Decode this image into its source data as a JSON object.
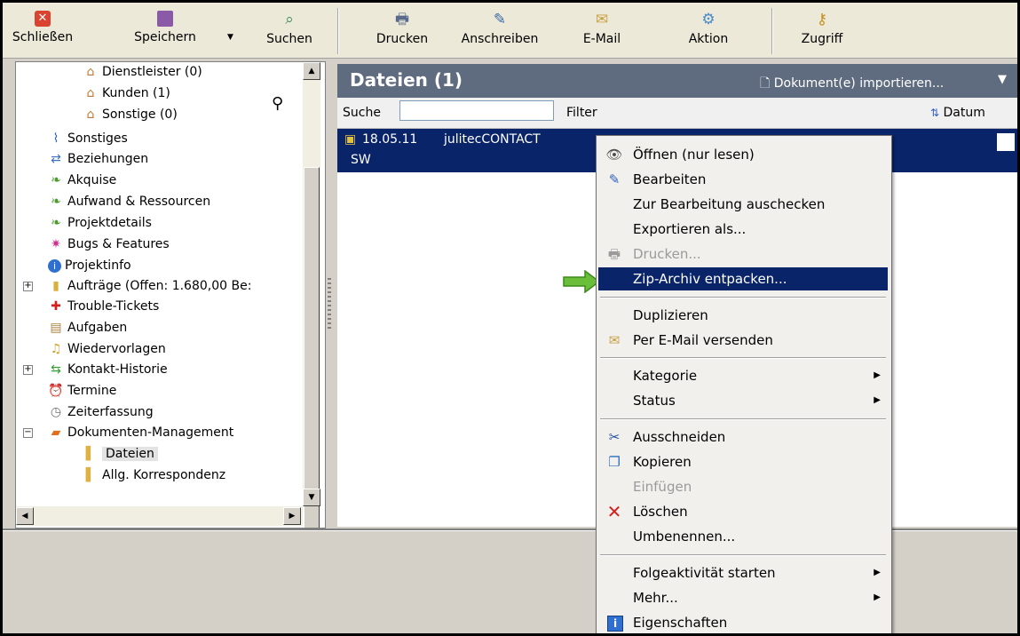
{
  "toolbar": {
    "buttons": [
      {
        "label": "Schließen",
        "icon": "close-icon"
      },
      {
        "label": "Speichern",
        "icon": "save-icon"
      },
      {
        "label": "Suchen",
        "icon": "search-icon"
      },
      {
        "label": "Drucken",
        "icon": "printer-icon"
      },
      {
        "label": "Anschreiben",
        "icon": "letter-icon"
      },
      {
        "label": "E-Mail",
        "icon": "email-icon"
      },
      {
        "label": "Aktion",
        "icon": "gear-icon"
      },
      {
        "label": "Zugriff",
        "icon": "keys-icon"
      }
    ]
  },
  "tree": {
    "items": [
      {
        "label": "Dienstleister (0)",
        "icon": "contacts-icon"
      },
      {
        "label": "Kunden (1)",
        "icon": "contacts-icon"
      },
      {
        "label": "Sonstige (0)",
        "icon": "contacts-icon"
      },
      {
        "label": "Sonstiges",
        "icon": "paperclip-icon"
      },
      {
        "label": "Beziehungen",
        "icon": "relations-icon"
      },
      {
        "label": "Akquise",
        "icon": "leaf-icon"
      },
      {
        "label": "Aufwand & Ressourcen",
        "icon": "leaf-icon"
      },
      {
        "label": "Projektdetails",
        "icon": "leaf-icon"
      },
      {
        "label": "Bugs & Features",
        "icon": "bug-icon"
      },
      {
        "label": "Projektinfo",
        "icon": "info-icon"
      },
      {
        "label": "Aufträge (Offen: 1.680,00 Be:",
        "icon": "orders-icon"
      },
      {
        "label": "Trouble-Tickets",
        "icon": "ticket-icon"
      },
      {
        "label": "Aufgaben",
        "icon": "clipboard-icon"
      },
      {
        "label": "Wiedervorlagen",
        "icon": "bell-icon"
      },
      {
        "label": "Kontakt-Historie",
        "icon": "history-icon"
      },
      {
        "label": "Termine",
        "icon": "alarm-clock-icon"
      },
      {
        "label": "Zeiterfassung",
        "icon": "stopwatch-icon"
      },
      {
        "label": "Dokumenten-Management",
        "icon": "documents-icon"
      },
      {
        "label": "Dateien",
        "icon": "folder-icon"
      },
      {
        "label": "Allg. Korrespondenz",
        "icon": "folder-icon"
      }
    ]
  },
  "files": {
    "title": "Dateien (1)",
    "import_label": "Dokument(e) importieren...",
    "search_label": "Suche",
    "search_value": "",
    "filter_label": "Filter",
    "sort_label": "Datum",
    "row": {
      "date": "18.05.11",
      "name": "julitecCONTACT",
      "name2": "SW"
    }
  },
  "context_menu": {
    "items": [
      {
        "label": "Öffnen (nur lesen)",
        "icon": "eye-icon"
      },
      {
        "label": "Bearbeiten",
        "icon": "edit-icon"
      },
      {
        "label": "Zur Bearbeitung auschecken",
        "icon": ""
      },
      {
        "label": "Exportieren als...",
        "icon": ""
      },
      {
        "label": "Drucken...",
        "icon": "printer-icon"
      },
      {
        "label": "Zip-Archiv entpacken...",
        "icon": ""
      },
      {
        "label": "Duplizieren",
        "icon": ""
      },
      {
        "label": "Per E-Mail versenden",
        "icon": "email-icon"
      },
      {
        "label": "Kategorie",
        "icon": ""
      },
      {
        "label": "Status",
        "icon": ""
      },
      {
        "label": "Ausschneiden",
        "icon": "scissors-icon"
      },
      {
        "label": "Kopieren",
        "icon": "copy-icon"
      },
      {
        "label": "Einfügen",
        "icon": ""
      },
      {
        "label": "Löschen",
        "icon": "delete-icon"
      },
      {
        "label": "Umbenennen...",
        "icon": ""
      },
      {
        "label": "Folgeaktivität starten",
        "icon": ""
      },
      {
        "label": "Mehr...",
        "icon": ""
      },
      {
        "label": "Eigenschaften",
        "icon": "info-icon"
      }
    ]
  },
  "colors": {
    "selection": "#0a246a",
    "header": "#5f6c7f",
    "arrow": "#6abf3a"
  }
}
